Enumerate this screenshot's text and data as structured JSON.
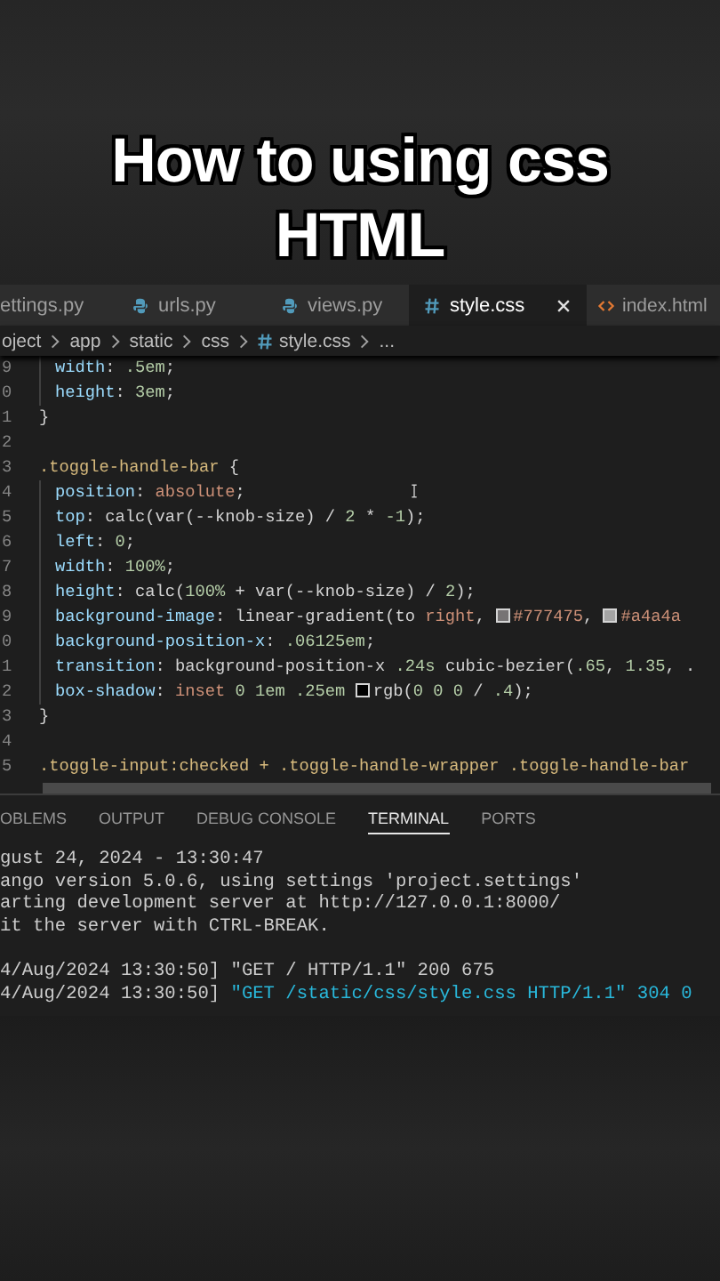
{
  "video_title": [
    "How to using css",
    "HTML"
  ],
  "tabs": [
    {
      "label": "ettings.py",
      "kind": "plain",
      "selected": false
    },
    {
      "label": "urls.py",
      "kind": "py",
      "selected": false
    },
    {
      "label": "views.py",
      "kind": "py",
      "selected": false
    },
    {
      "label": "style.css",
      "kind": "css",
      "selected": true
    },
    {
      "label": "index.html",
      "kind": "html",
      "selected": false
    }
  ],
  "breadcrumb": [
    {
      "label": "oject",
      "kind": "folder"
    },
    {
      "label": "app",
      "kind": "folder"
    },
    {
      "label": "static",
      "kind": "folder"
    },
    {
      "label": "css",
      "kind": "folder"
    },
    {
      "label": "style.css",
      "kind": "css"
    },
    {
      "label": "...",
      "kind": "folder"
    }
  ],
  "code_lines": [
    {
      "number": "9",
      "indent": true,
      "tokens": [
        {
          "kind": "prop",
          "text": "width"
        },
        {
          "kind": "punct",
          "text": ": "
        },
        {
          "kind": "num",
          "text": ".5em"
        },
        {
          "kind": "punct",
          "text": ";"
        }
      ]
    },
    {
      "number": "0",
      "indent": true,
      "tokens": [
        {
          "kind": "prop",
          "text": "height"
        },
        {
          "kind": "punct",
          "text": ": "
        },
        {
          "kind": "num",
          "text": "3em"
        },
        {
          "kind": "punct",
          "text": ";"
        }
      ]
    },
    {
      "number": "1",
      "indent": false,
      "tokens": [
        {
          "kind": "punct",
          "text": "}"
        }
      ]
    },
    {
      "number": "2",
      "indent": false
    },
    {
      "number": "3",
      "indent": false,
      "tokens": [
        {
          "kind": "sel",
          "text": ".toggle-handle-bar"
        },
        {
          "kind": "punct",
          "text": " {"
        }
      ]
    },
    {
      "number": "4",
      "indent": true,
      "tokens": [
        {
          "kind": "prop",
          "text": "position"
        },
        {
          "kind": "punct",
          "text": ": "
        },
        {
          "kind": "value",
          "text": "absolute"
        },
        {
          "kind": "punct",
          "text": ";"
        }
      ]
    },
    {
      "number": "5",
      "indent": true,
      "tokens": [
        {
          "kind": "prop",
          "text": "top"
        },
        {
          "kind": "punct",
          "text": ": calc(var(--knob-size) / "
        },
        {
          "kind": "num",
          "text": "2"
        },
        {
          "kind": "punct",
          "text": " * "
        },
        {
          "kind": "num",
          "text": "-1"
        },
        {
          "kind": "punct",
          "text": ");"
        }
      ]
    },
    {
      "number": "6",
      "indent": true,
      "tokens": [
        {
          "kind": "prop",
          "text": "left"
        },
        {
          "kind": "punct",
          "text": ": "
        },
        {
          "kind": "num",
          "text": "0"
        },
        {
          "kind": "punct",
          "text": ";"
        }
      ]
    },
    {
      "number": "7",
      "indent": true,
      "tokens": [
        {
          "kind": "prop",
          "text": "width"
        },
        {
          "kind": "punct",
          "text": ": "
        },
        {
          "kind": "num",
          "text": "100%"
        },
        {
          "kind": "punct",
          "text": ";"
        }
      ]
    },
    {
      "number": "8",
      "indent": true,
      "tokens": [
        {
          "kind": "prop",
          "text": "height"
        },
        {
          "kind": "punct",
          "text": ": calc("
        },
        {
          "kind": "num",
          "text": "100%"
        },
        {
          "kind": "punct",
          "text": " + var(--knob-size) / "
        },
        {
          "kind": "num",
          "text": "2"
        },
        {
          "kind": "punct",
          "text": ");"
        }
      ]
    },
    {
      "number": "9",
      "indent": true,
      "tokens": [
        {
          "kind": "prop",
          "text": "background-image"
        },
        {
          "kind": "punct",
          "text": ": linear-gradient(to "
        },
        {
          "kind": "value",
          "text": "right"
        },
        {
          "kind": "punct",
          "text": ", "
        },
        {
          "kind": "swatch",
          "color": "#777475"
        },
        {
          "kind": "value",
          "text": "#777475"
        },
        {
          "kind": "punct",
          "text": ", "
        },
        {
          "kind": "swatch",
          "color": "#a4a4a4"
        },
        {
          "kind": "value",
          "text": "#a4a4a"
        }
      ]
    },
    {
      "number": "0",
      "indent": true,
      "tokens": [
        {
          "kind": "prop",
          "text": "background-position-x"
        },
        {
          "kind": "punct",
          "text": ": "
        },
        {
          "kind": "num",
          "text": ".06125em"
        },
        {
          "kind": "punct",
          "text": ";"
        }
      ]
    },
    {
      "number": "1",
      "indent": true,
      "tokens": [
        {
          "kind": "prop",
          "text": "transition"
        },
        {
          "kind": "punct",
          "text": ": background-position-x "
        },
        {
          "kind": "num",
          "text": ".24s"
        },
        {
          "kind": "punct",
          "text": " cubic-bezier("
        },
        {
          "kind": "num",
          "text": ".65"
        },
        {
          "kind": "punct",
          "text": ", "
        },
        {
          "kind": "num",
          "text": "1.35"
        },
        {
          "kind": "punct",
          "text": ", ."
        }
      ]
    },
    {
      "number": "2",
      "indent": true,
      "tokens": [
        {
          "kind": "prop",
          "text": "box-shadow"
        },
        {
          "kind": "punct",
          "text": ": "
        },
        {
          "kind": "value",
          "text": "inset "
        },
        {
          "kind": "num",
          "text": "0 1em .25em "
        },
        {
          "kind": "swatch",
          "color": "#000000"
        },
        {
          "kind": "punct",
          "text": "rgb("
        },
        {
          "kind": "num",
          "text": "0 0 0"
        },
        {
          "kind": "punct",
          "text": " / "
        },
        {
          "kind": "num",
          "text": ".4"
        },
        {
          "kind": "punct",
          "text": ");"
        }
      ]
    },
    {
      "number": "3",
      "indent": false,
      "tokens": [
        {
          "kind": "punct",
          "text": "}"
        }
      ]
    },
    {
      "number": "4",
      "indent": false
    },
    {
      "number": "5",
      "indent": false,
      "tokens": [
        {
          "kind": "sel",
          "text": ".toggle-input:checked + .toggle-handle-wrapper .toggle-handle-bar"
        }
      ]
    }
  ],
  "panel_tabs": [
    {
      "label": "OBLEMS",
      "selected": false
    },
    {
      "label": "OUTPUT",
      "selected": false
    },
    {
      "label": "DEBUG CONSOLE",
      "selected": false
    },
    {
      "label": "TERMINAL",
      "selected": true
    },
    {
      "label": "PORTS",
      "selected": false
    }
  ],
  "terminal_lines": [
    {
      "gap_before": false,
      "segments": [
        {
          "kind": "plain",
          "text": "gust 24, 2024 - 13:30:47"
        }
      ]
    },
    {
      "gap_before": false,
      "segments": [
        {
          "kind": "plain",
          "text": "ango version 5.0.6, using settings 'project.settings'"
        }
      ]
    },
    {
      "gap_before": false,
      "segments": [
        {
          "kind": "plain",
          "text": "arting development server at http://127.0.0.1:8000/"
        }
      ]
    },
    {
      "gap_before": false,
      "segments": [
        {
          "kind": "plain",
          "text": "it the server with CTRL-BREAK."
        }
      ]
    },
    {
      "gap_before": true,
      "segments": [
        {
          "kind": "plain",
          "text": "4/Aug/2024 13:30:50] \"GET / HTTP/1.1\" 200 675"
        }
      ]
    },
    {
      "gap_before": false,
      "segments": [
        {
          "kind": "plain",
          "text": "4/Aug/2024 13:30:50] "
        },
        {
          "kind": "teal",
          "text": "\"GET /static/css/style.css HTTP/1.1\" 304 0"
        }
      ]
    }
  ]
}
